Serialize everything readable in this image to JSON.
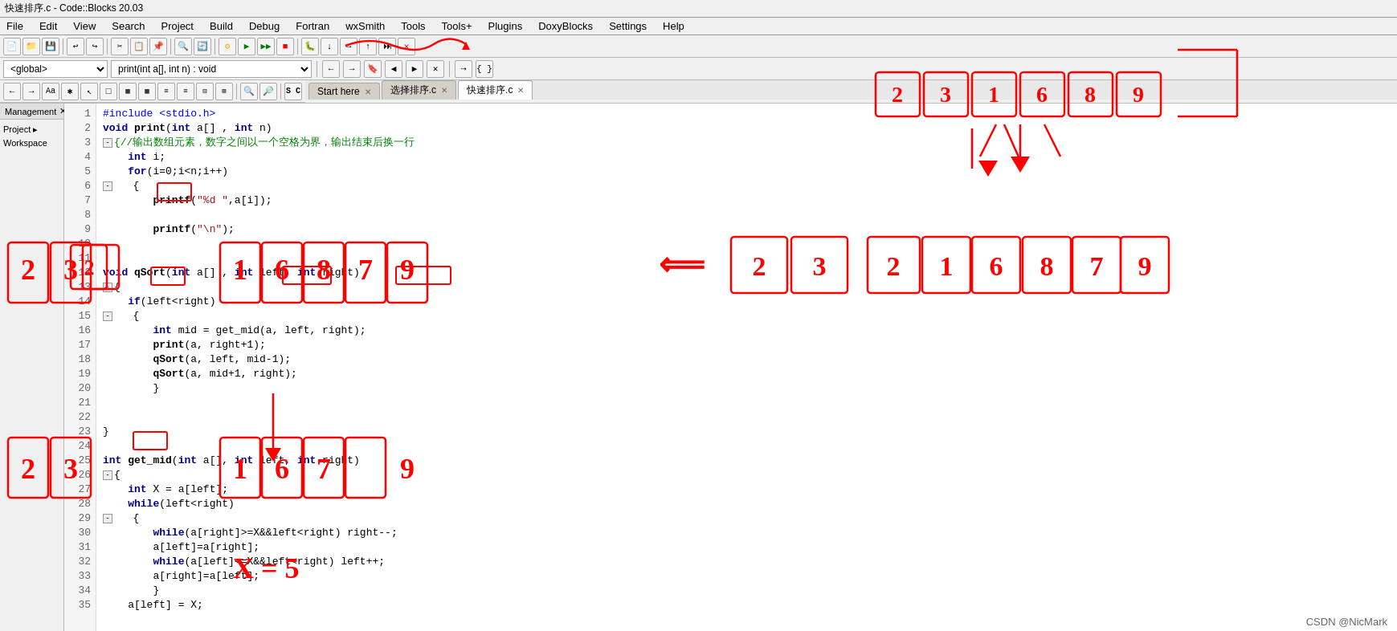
{
  "titleBar": {
    "text": "快速排序.c - Code::Blocks 20.03"
  },
  "menuBar": {
    "items": [
      "File",
      "Edit",
      "View",
      "Search",
      "Project",
      "Build",
      "Debug",
      "Fortran",
      "wxSmith",
      "Tools",
      "Tools+",
      "Plugins",
      "DoxyBlocks",
      "Settings",
      "Help"
    ]
  },
  "toolbar1": {
    "dropdowns": [
      "<global>",
      "print(int a[], int n) : void"
    ]
  },
  "tabs": [
    {
      "label": "Start here",
      "active": false
    },
    {
      "label": "选择排序.c",
      "active": false
    },
    {
      "label": "快速排序.c",
      "active": true
    }
  ],
  "leftPanel": {
    "tabs": [
      "Management ×"
    ],
    "items": [
      "Project",
      "Workspace"
    ]
  },
  "code": {
    "lines": [
      {
        "num": 1,
        "indent": 0,
        "text": "#include <stdio.h>",
        "type": "pp"
      },
      {
        "num": 2,
        "indent": 0,
        "text": "void print(int a[] , int n)",
        "type": "mixed"
      },
      {
        "num": 3,
        "indent": 0,
        "text": "{//输出数组元素，数字之间以一个空格为界，输出结束后换一行",
        "type": "comment"
      },
      {
        "num": 4,
        "indent": 1,
        "text": "int i;",
        "type": "mixed"
      },
      {
        "num": 5,
        "indent": 1,
        "text": "for(i=0;i<n;i++)",
        "type": "mixed"
      },
      {
        "num": 6,
        "indent": 1,
        "text": "{",
        "type": "normal"
      },
      {
        "num": 7,
        "indent": 2,
        "text": "printf(\"%d \",a[i]);",
        "type": "mixed"
      },
      {
        "num": 8,
        "indent": 1,
        "text": "",
        "type": "normal"
      },
      {
        "num": 9,
        "indent": 2,
        "text": "printf(\"\\n\");",
        "type": "mixed"
      },
      {
        "num": 10,
        "indent": 0,
        "text": "",
        "type": "normal"
      },
      {
        "num": 11,
        "indent": 0,
        "text": "",
        "type": "normal"
      },
      {
        "num": 12,
        "indent": 0,
        "text": "void qSort(int a[] , int left, int right)",
        "type": "mixed"
      },
      {
        "num": 13,
        "indent": 0,
        "text": "{",
        "type": "normal"
      },
      {
        "num": 14,
        "indent": 1,
        "text": "if(left<right)",
        "type": "mixed"
      },
      {
        "num": 15,
        "indent": 1,
        "text": "{",
        "type": "normal"
      },
      {
        "num": 16,
        "indent": 2,
        "text": "int mid = get_mid(a, left, right);",
        "type": "mixed"
      },
      {
        "num": 17,
        "indent": 2,
        "text": "print(a, right+1);",
        "type": "mixed"
      },
      {
        "num": 18,
        "indent": 2,
        "text": "qSort(a, left, mid-1);",
        "type": "mixed"
      },
      {
        "num": 19,
        "indent": 2,
        "text": "qSort(a, mid+1, right);",
        "type": "mixed"
      },
      {
        "num": 20,
        "indent": 2,
        "text": "}",
        "type": "normal"
      },
      {
        "num": 21,
        "indent": 0,
        "text": "",
        "type": "normal"
      },
      {
        "num": 22,
        "indent": 0,
        "text": "",
        "type": "normal"
      },
      {
        "num": 23,
        "indent": 0,
        "text": "}",
        "type": "normal"
      },
      {
        "num": 24,
        "indent": 0,
        "text": "",
        "type": "normal"
      },
      {
        "num": 25,
        "indent": 0,
        "text": "int get_mid(int a[], int left, int right)",
        "type": "mixed"
      },
      {
        "num": 26,
        "indent": 0,
        "text": "{",
        "type": "normal"
      },
      {
        "num": 27,
        "indent": 1,
        "text": "int X = a[left];",
        "type": "mixed"
      },
      {
        "num": 28,
        "indent": 1,
        "text": "while(left<right)",
        "type": "mixed"
      },
      {
        "num": 29,
        "indent": 1,
        "text": "{",
        "type": "normal"
      },
      {
        "num": 30,
        "indent": 2,
        "text": "while(a[right]>=X&&left<right) right--;",
        "type": "mixed"
      },
      {
        "num": 31,
        "indent": 2,
        "text": "a[left]=a[right];",
        "type": "mixed"
      },
      {
        "num": 32,
        "indent": 2,
        "text": "while(a[left]<=X&&left<right) left++;",
        "type": "mixed"
      },
      {
        "num": 33,
        "indent": 2,
        "text": "a[right]=a[left];",
        "type": "mixed"
      },
      {
        "num": 34,
        "indent": 2,
        "text": "}",
        "type": "normal"
      },
      {
        "num": 35,
        "indent": 1,
        "text": "a[left] = X;",
        "type": "mixed"
      }
    ]
  },
  "annotations": {
    "topRight": {
      "numbers": [
        "2",
        "3",
        "1",
        "6",
        "8",
        "9"
      ],
      "label": "top-right array boxes"
    },
    "middleRight": {
      "numbers": [
        "2",
        "3",
        "2",
        "1",
        "6",
        "8",
        "7",
        "9"
      ],
      "label": "middle right array after sort"
    },
    "leftSide": {
      "top": [
        "2",
        "3",
        "1",
        "6",
        "8",
        "7",
        "9"
      ],
      "bottom": [
        "2",
        "3",
        "6",
        "7",
        "9"
      ]
    },
    "arrow": "←"
  },
  "watermark": "CSDN @NicMark"
}
